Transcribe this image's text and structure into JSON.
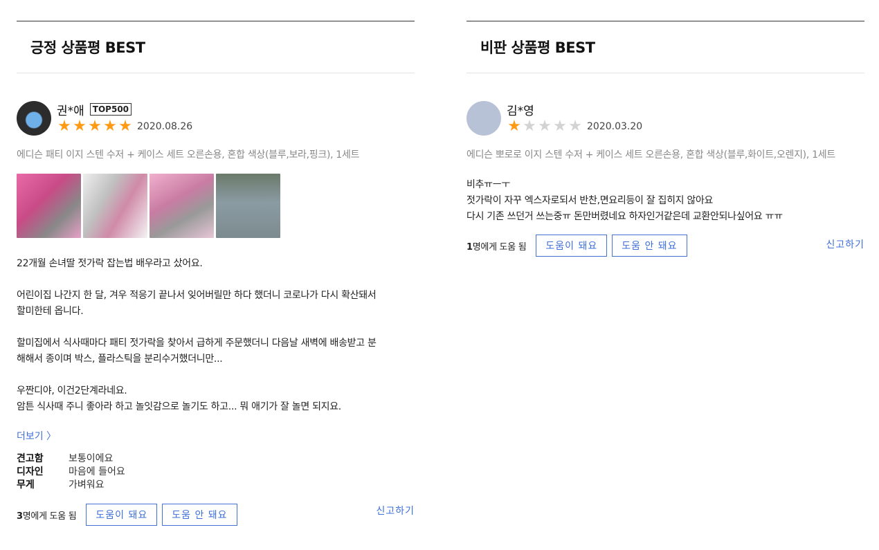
{
  "positive": {
    "title": "긍정 상품평 BEST",
    "reviewer": {
      "name": "권*애",
      "badge": "TOP500"
    },
    "rating": 5,
    "stars": [
      "★",
      "★",
      "★",
      "★",
      "★"
    ],
    "date": "2020.08.26",
    "option": "에디슨 패티 이지 스텐 수저 + 케이스 세트 오른손용, 혼합 색상(블루,보라,핑크), 1세트",
    "paragraphs": [
      "22개월 손녀딸 젓가락 잡는법 배우라고 샀어요.",
      "어린이집 나간지 한 달, 겨우 적응기 끝나서 잊어버릴만 하다 했더니 코로나가 다시 확산돼서\n할미한테 옵니다.",
      "할미집에서 식사때마다 패티 젓가락을 찾아서 급하게 주문했더니 다음날 새벽에 배송받고 분\n해해서 종이며 박스, 플라스틱을 분리수거했더니만...",
      "우짠디야, 이건2단계라네요.\n암튼 식사때 주니 좋아라 하고 놀잇감으로 놀기도 하고... 뭐 애기가 잘 놀면 되지요."
    ],
    "more_label": "더보기 〉",
    "survey": [
      {
        "key": "견고함",
        "value": "보통이에요"
      },
      {
        "key": "디자인",
        "value": "마음에 들어요"
      },
      {
        "key": "무게",
        "value": "가벼워요"
      }
    ],
    "help_count": "3",
    "help_suffix": "명에게 도움 됨",
    "helpful_label": "도움이 돼요",
    "not_helpful_label": "도움 안 돼요",
    "report_label": "신고하기"
  },
  "negative": {
    "title": "비판 상품평 BEST",
    "reviewer": {
      "name": "김*영"
    },
    "rating": 1,
    "stars": [
      "★",
      "★",
      "★",
      "★",
      "★"
    ],
    "date": "2020.03.20",
    "option": "에디슨 뽀로로 이지 스텐 수저 + 케이스 세트 오른손용, 혼합 색상(블루,화이트,오렌지), 1세트",
    "paragraphs": [
      "비추ㅠㅡㅜ\n젓가락이 자꾸 엑스자로되서 반찬,면요리등이 잘 집히지 않아요\n다시 기존 쓰던거 쓰는중ㅠ 돈만버렸네요 하자인거같은데 교환안되나싶어요 ㅠㅠ"
    ],
    "help_count": "1",
    "help_suffix": "명에게 도움 됨",
    "helpful_label": "도움이 돼요",
    "not_helpful_label": "도움 안 돼요",
    "report_label": "신고하기"
  }
}
